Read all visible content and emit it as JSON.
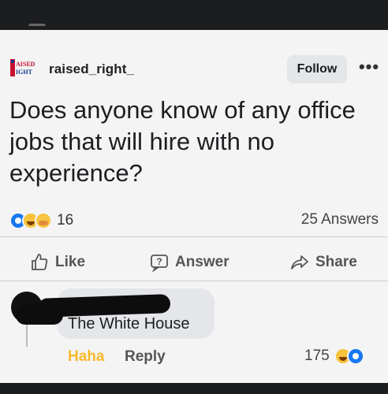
{
  "post": {
    "username": "raised_right_",
    "avatar_text": "RAISED RIGHT",
    "follow_label": "Follow",
    "more_label": "•••",
    "question": "Does anyone know of any office jobs that will hire with no experience?",
    "reaction_count": "16",
    "answers_count": "25 Answers"
  },
  "actions": {
    "like_label": "Like",
    "answer_label": "Answer",
    "share_label": "Share"
  },
  "comment": {
    "text": "The White House",
    "haha_label": "Haha",
    "reply_label": "Reply",
    "reaction_count": "175"
  },
  "colors": {
    "haha": "#f7b928",
    "like_blue": "#1877f2",
    "card_bg": "#f4f4f4",
    "frame_bg": "#1c1d1f"
  },
  "icons": {
    "reactions": [
      "like-reaction-icon",
      "haha-reaction-icon",
      "care-reaction-icon"
    ],
    "like": "thumbs-up-icon",
    "answer": "question-bubble-icon",
    "share": "share-arrow-icon"
  }
}
